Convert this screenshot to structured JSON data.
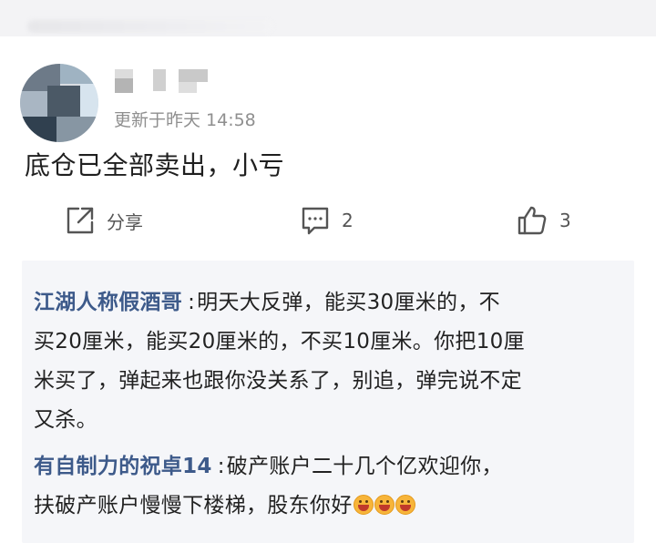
{
  "post": {
    "updated_prefix": "更新于昨天",
    "updated_time": "14:58",
    "content": "底仓已全部卖出，小亏"
  },
  "actions": {
    "share_label": "分享",
    "comment_count": "2",
    "like_count": "3"
  },
  "replies": [
    {
      "author": "江湖人称假酒哥",
      "lines": [
        "明天大反弹，能买30厘米的，不",
        "买20厘米，能买20厘米的，不买10厘米。你把10厘",
        "米买了，弹起来也跟你没关系了，别追，弹完说不定",
        "又杀。"
      ]
    },
    {
      "author": "有自制力的祝卓14",
      "lines": [
        "破产账户二十几个亿欢迎你，",
        "扶破产账户慢慢下楼梯，股东你好"
      ],
      "emojis": [
        "grinning-squinting-emoji",
        "grinning-squinting-emoji",
        "grinning-squinting-emoji"
      ]
    }
  ],
  "colors": {
    "reply_author": "#3d5a8a",
    "reply_bg": "#f5f6f9",
    "meta_gray": "#8f8f8f"
  },
  "icons": {
    "share": "share-icon",
    "comment": "comment-icon",
    "like": "thumbs-up-icon"
  }
}
